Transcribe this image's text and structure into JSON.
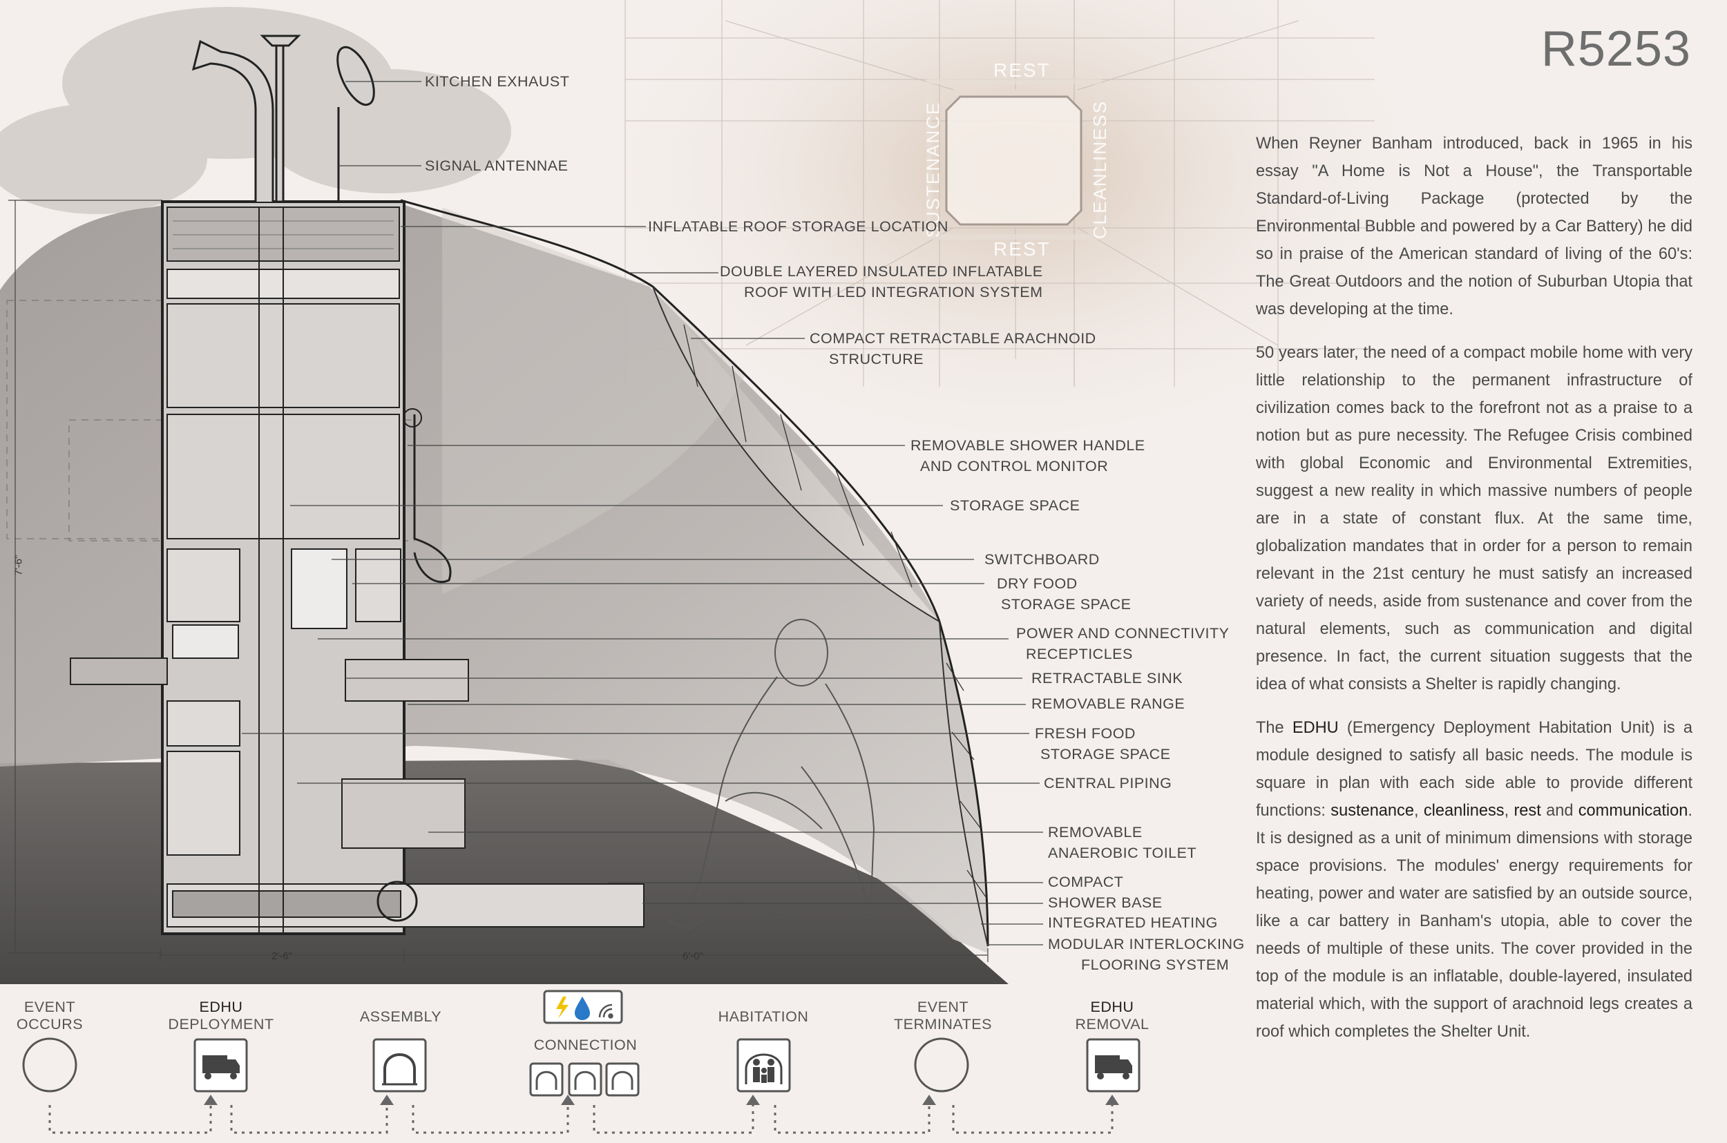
{
  "code": "R5253",
  "essay": {
    "p1": "When Reyner Banham introduced, back in 1965 in his essay \"A Home is Not a House\", the Transportable Standard-of-Living Package (protected by the Environmental Bubble and powered by a Car Battery) he did so in praise of the American standard of living of the 60's: The Great Outdoors and the notion of Suburban Utopia that was developing at the time.",
    "p2": "50 years later, the need of a compact mobile home with very little relationship to the permanent infrastructure of civilization comes back to the forefront not as a praise to a notion but as pure necessity. The Refugee Crisis combined with global Economic and Environmental Extremities, suggest a new reality in which massive numbers of people are in a state of constant flux. At the same time, globalization mandates that in order for a person to remain relevant in the 21st century he must satisfy an increased variety of needs, aside from sustenance and cover from the natural elements, such as communication and digital presence. In fact, the current situation suggests that the idea of what consists a Shelter is rapidly changing.",
    "p3_a": "The ",
    "p3_edhu": "EDHU",
    "p3_b": " (Emergency Deployment Habitation Unit) is a module designed to satisfy all basic needs. The module is square in plan with each side able to provide different functions: ",
    "p3_k1": "sustenance",
    "p3_c1": ", ",
    "p3_k2": "cleanliness",
    "p3_c2": ", ",
    "p3_k3": "rest",
    "p3_c3": " and ",
    "p3_k4": "communication",
    "p3_c": ". It is designed as a unit of minimum dimensions with storage space provisions. The modules' energy requirements for heating, power and water are satisfied by an outside source, like a car battery in Banham's utopia, able to cover the needs of multiple of these units. The cover provided in the top of the module is an inflatable, double-layered, insulated material which, with the support of arachnoid legs creates a roof which completes the Shelter Unit."
  },
  "plan_labels": {
    "rest_top": "REST",
    "rest_bottom": "REST",
    "sustenance": "SUSTENANCE",
    "cleanliness": "CLEANLINESS"
  },
  "labels": {
    "kitchen_exhaust": "KITCHEN EXHAUST",
    "signal_antennae": "SIGNAL ANTENNAE",
    "inflatable_roof_storage": "INFLATABLE ROOF STORAGE LOCATION",
    "double_layered_1": "DOUBLE LAYERED INSULATED INFLATABLE",
    "double_layered_2": "ROOF WITH LED INTEGRATION SYSTEM",
    "arachnoid_1": "COMPACT RETRACTABLE ARACHNOID",
    "arachnoid_2": "STRUCTURE",
    "shower_handle_1": "REMOVABLE SHOWER HANDLE",
    "shower_handle_2": "AND CONTROL MONITOR",
    "storage_space": "STORAGE SPACE",
    "switchboard": "SWITCHBOARD",
    "dry_food_1": "DRY FOOD",
    "dry_food_2": "STORAGE SPACE",
    "power_1": "POWER AND CONNECTIVITY",
    "power_2": "RECEPTICLES",
    "sink": "RETRACTABLE SINK",
    "range": "REMOVABLE RANGE",
    "fresh_food_1": "FRESH FOOD",
    "fresh_food_2": "STORAGE SPACE",
    "piping": "CENTRAL PIPING",
    "toilet_1": "REMOVABLE",
    "toilet_2": "ANAEROBIC TOILET",
    "shower_1": "COMPACT",
    "shower_2": "SHOWER BASE",
    "heating": "INTEGRATED HEATING",
    "flooring_1": "MODULAR INTERLOCKING",
    "flooring_2": "FLOORING SYSTEM"
  },
  "dimensions": {
    "height": "7'-6\"",
    "module_width": "2'-6\"",
    "roof_span": "6'-0\""
  },
  "timeline": {
    "event_occurs_1": "EVENT",
    "event_occurs_2": "OCCURS",
    "deploy_1": "EDHU",
    "deploy_2": "DEPLOYMENT",
    "assembly": "ASSEMBLY",
    "connection": "CONNECTION",
    "habitation": "HABITATION",
    "terminates_1": "EVENT",
    "terminates_2": "TERMINATES",
    "removal_1": "EDHU",
    "removal_2": "REMOVAL"
  },
  "icons": [
    "truck-icon",
    "arch-icon",
    "power-icon",
    "water-icon",
    "wifi-icon",
    "family-icon"
  ],
  "colors": {
    "background": "#f4efec",
    "ink": "#333333",
    "icon_yellow": "#f2c200",
    "icon_blue": "#2a78c8"
  }
}
